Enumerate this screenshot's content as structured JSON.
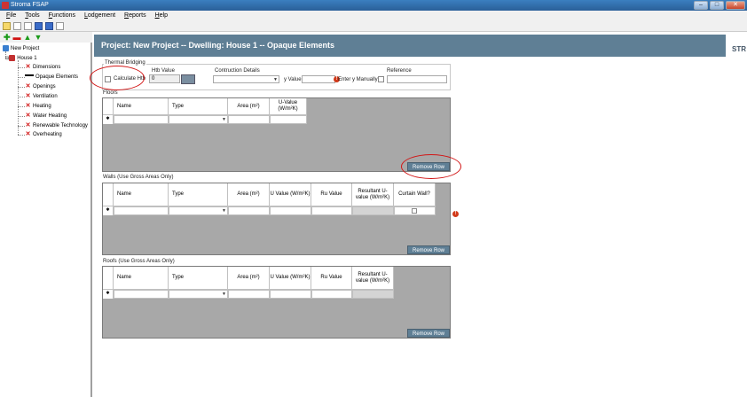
{
  "window": {
    "title": "Stroma FSAP"
  },
  "menu": [
    "File",
    "Tools",
    "Functions",
    "Lodgement",
    "Reports",
    "Help"
  ],
  "tree": {
    "root": "New Project",
    "house": "House 1",
    "items": [
      "Dimensions",
      "Opaque Elements",
      "Openings",
      "Ventilation",
      "Heating",
      "Water Heating",
      "Renewable Technology",
      "Overheating"
    ]
  },
  "header": {
    "title": "Project: New Project -- Dwelling: House 1 -- Opaque Elements",
    "logo": "STR"
  },
  "thermal": {
    "group_label": "Thermal Bridging",
    "calculate_htb": "Calculate Htb",
    "htb_value_label": "Htb Value",
    "htb_value": "0",
    "construction_label": "Contruction Details",
    "y_value_label": "y Value",
    "enter_y_manually": "Enter y Manually",
    "reference_label": "Reference"
  },
  "floors": {
    "label": "Floors",
    "columns": [
      "Name",
      "Type",
      "Area (m²)",
      "U-Value (W/m²K)"
    ],
    "remove_row": "Remove Row"
  },
  "walls": {
    "label": "Walls (Use Gross Areas Only)",
    "columns": [
      "Name",
      "Type",
      "Area (m²)",
      "U Value (W/m²K)",
      "Ru Value",
      "Resultant U-value (W/m²K)",
      "Curtain Wall?"
    ],
    "remove_row": "Remove Row"
  },
  "roofs": {
    "label": "Roofs (Use Gross Areas Only)",
    "columns": [
      "Name",
      "Type",
      "Area (m²)",
      "U Value (W/m²K)",
      "Ru Value",
      "Resultant U-value (W/m²K)"
    ],
    "remove_row": "Remove Row"
  },
  "colors": {
    "accent": "#5f7f95",
    "grid_bg": "#a8a8a8",
    "annotation": "#d21616"
  }
}
